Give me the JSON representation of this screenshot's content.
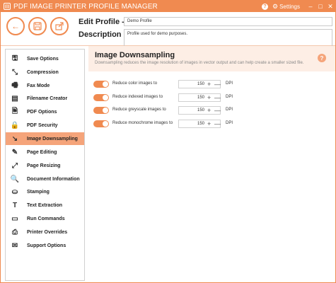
{
  "window": {
    "title": "PDF IMAGE PRINTER PROFILE MANAGER",
    "settings_label": "Settings",
    "minimize": "–",
    "maximize": "□",
    "close": "✕"
  },
  "header": {
    "edit_label": "Edit Profile -",
    "description_label": "Description",
    "profile_name": "Demo Profile",
    "profile_description": "Profile used for demo purposes."
  },
  "sidebar": {
    "items": [
      {
        "label": "Save Options",
        "icon": "save-options-icon",
        "glyph": "🖫"
      },
      {
        "label": "Compression",
        "icon": "compression-icon",
        "glyph": "⤡"
      },
      {
        "label": "Fax Mode",
        "icon": "fax-icon",
        "glyph": "🖷"
      },
      {
        "label": "Filename Creator",
        "icon": "filename-icon",
        "glyph": "▤"
      },
      {
        "label": "PDF Options",
        "icon": "pdf-options-icon",
        "glyph": "🗎"
      },
      {
        "label": "PDF Security",
        "icon": "pdf-security-icon",
        "glyph": "🔒"
      },
      {
        "label": "Image Downsampling",
        "icon": "downsampling-icon",
        "glyph": "↘"
      },
      {
        "label": "Page Editing",
        "icon": "page-editing-icon",
        "glyph": "✎"
      },
      {
        "label": "Page Resizing",
        "icon": "page-resizing-icon",
        "glyph": "⤢"
      },
      {
        "label": "Document Information",
        "icon": "document-info-icon",
        "glyph": "🔍"
      },
      {
        "label": "Stamping",
        "icon": "stamp-icon",
        "glyph": "⛀"
      },
      {
        "label": "Text Extraction",
        "icon": "text-extraction-icon",
        "glyph": "T"
      },
      {
        "label": "Run Commands",
        "icon": "run-commands-icon",
        "glyph": "▭"
      },
      {
        "label": "Printer Overrides",
        "icon": "printer-overrides-icon",
        "glyph": "⎙"
      },
      {
        "label": "Support Options",
        "icon": "support-options-icon",
        "glyph": "✉"
      }
    ],
    "active_index": 6
  },
  "main": {
    "title": "Image Downsampling",
    "description": "Downsampling reduces the image resolution of images in vector output and can help create a smaller sized file.",
    "help": "?",
    "rows": [
      {
        "label": "Reduce color images to",
        "value": "150",
        "unit": "DPI",
        "enabled": true
      },
      {
        "label": "Reduce indexed images to",
        "value": "150",
        "unit": "DPI",
        "enabled": true
      },
      {
        "label": "Reduce greyscale images to",
        "value": "150",
        "unit": "DPI",
        "enabled": true
      },
      {
        "label": "Reduce monochrome images to",
        "value": "150",
        "unit": "DPI",
        "enabled": true
      }
    ]
  },
  "colors": {
    "accent": "#f08a50",
    "active_item": "#f5a47a",
    "panel_header": "#fdeee5"
  }
}
